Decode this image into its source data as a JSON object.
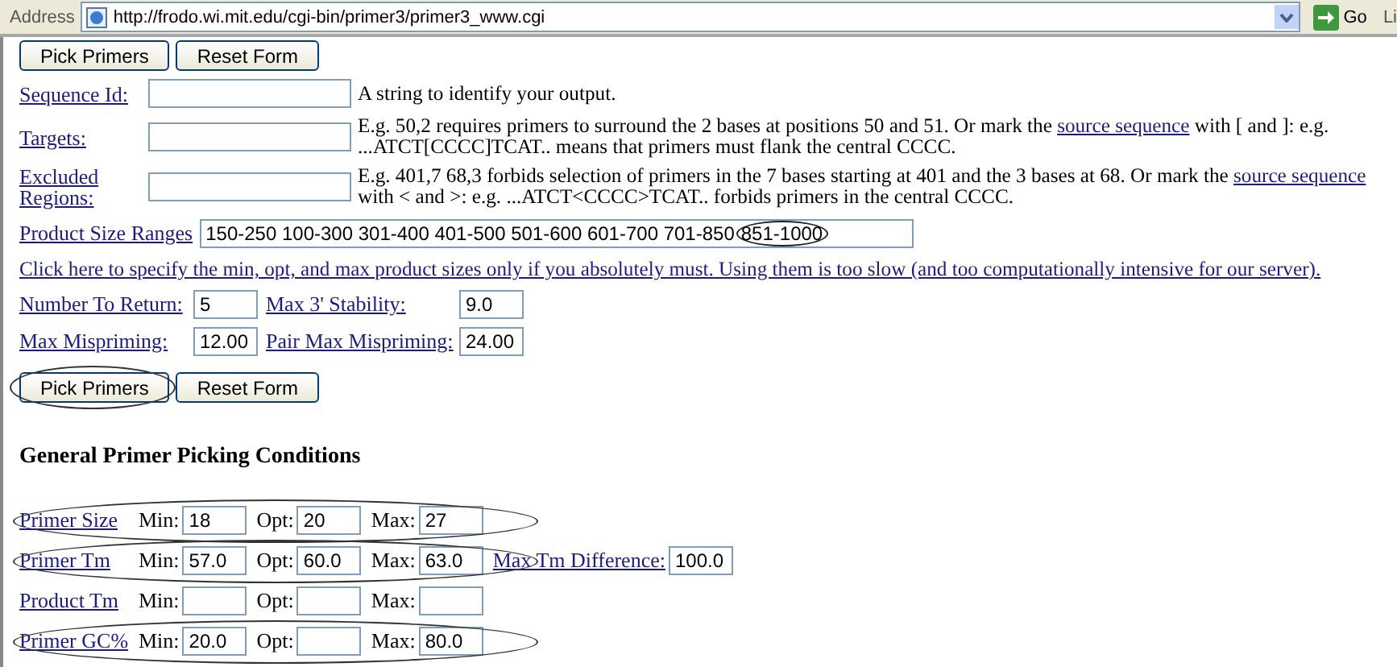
{
  "address_bar": {
    "label": "Address",
    "url": "http://frodo.wi.mit.edu/cgi-bin/primer3/primer3_www.cgi",
    "go": "Go",
    "links": "Li"
  },
  "top_buttons": [
    {
      "label": "Pick Primers",
      "circled": false
    },
    {
      "label": "Reset Form",
      "circled": false
    }
  ],
  "fields": [
    {
      "label": "Sequence Id:",
      "description": [
        {
          "kind": "text",
          "text": "A string to identify your output."
        }
      ]
    },
    {
      "label": "Targets:",
      "description": [
        {
          "kind": "text",
          "text": "E.g. 50,2 requires primers to surround the 2 bases at positions 50 and 51. Or mark the"
        },
        {
          "kind": "link",
          "text": "source sequence"
        },
        {
          "kind": "text",
          "text": "with [ and ]: e.g. ...ATCT[CCCC]TCAT.. means that primers must flank the central CCCC."
        }
      ]
    },
    {
      "label": "Excluded Regions:",
      "description": [
        {
          "kind": "text",
          "text": "E.g. 401,7 68,3 forbids selection of primers in the 7 bases starting at 401 and the 3 bases at 68. Or mark the"
        },
        {
          "kind": "link",
          "text": "source sequence"
        },
        {
          "kind": "text",
          "text": "with < and >: e.g. ...ATCT<CCCC>TCAT.. forbids primers in the central CCCC."
        }
      ]
    }
  ],
  "product_size": {
    "label": "Product Size Ranges",
    "value": "150-250 100-300 301-400 401-500 501-600 601-700 701-850",
    "circled_value": "851-1000"
  },
  "info_link": "Click here to specify the min, opt, and max product sizes only if you absolutely must. Using them is too slow (and too computationally intensive for our server).",
  "params": [
    [
      {
        "label": "Number To Return:",
        "value": "5"
      },
      {
        "label": "Max 3' Stability:",
        "value": "9.0"
      }
    ],
    [
      {
        "label": "Max Mispriming:",
        "value": "12.00"
      },
      {
        "label": "Pair Max Mispriming:",
        "value": "24.00"
      }
    ]
  ],
  "bottom_buttons": [
    {
      "label": "Pick Primers",
      "circled": true
    },
    {
      "label": "Reset Form",
      "circled": false
    }
  ],
  "section_title": "General Primer Picking Conditions",
  "conditions": [
    {
      "label": "Primer Size",
      "circled": true,
      "fields": [
        {
          "label": "Min:",
          "value": "18"
        },
        {
          "label": "Opt:",
          "value": "20"
        },
        {
          "label": "Max:",
          "value": "27"
        }
      ]
    },
    {
      "label": "Primer Tm",
      "circled": true,
      "fields": [
        {
          "label": "Min:",
          "value": "57.0"
        },
        {
          "label": "Opt:",
          "value": "60.0"
        },
        {
          "label": "Max:",
          "value": "63.0"
        }
      ],
      "extra": {
        "label": "Max Tm Difference:",
        "value": "100.0"
      }
    },
    {
      "label": "Product Tm",
      "circled": false,
      "fields": [
        {
          "label": "Min:"
        },
        {
          "label": "Opt:"
        },
        {
          "label": "Max:"
        }
      ]
    },
    {
      "label": "Primer GC%",
      "circled": true,
      "fields": [
        {
          "label": "Min:",
          "value": "20.0"
        },
        {
          "label": "Opt:"
        },
        {
          "label": "Max:",
          "value": "80.0"
        }
      ]
    }
  ]
}
